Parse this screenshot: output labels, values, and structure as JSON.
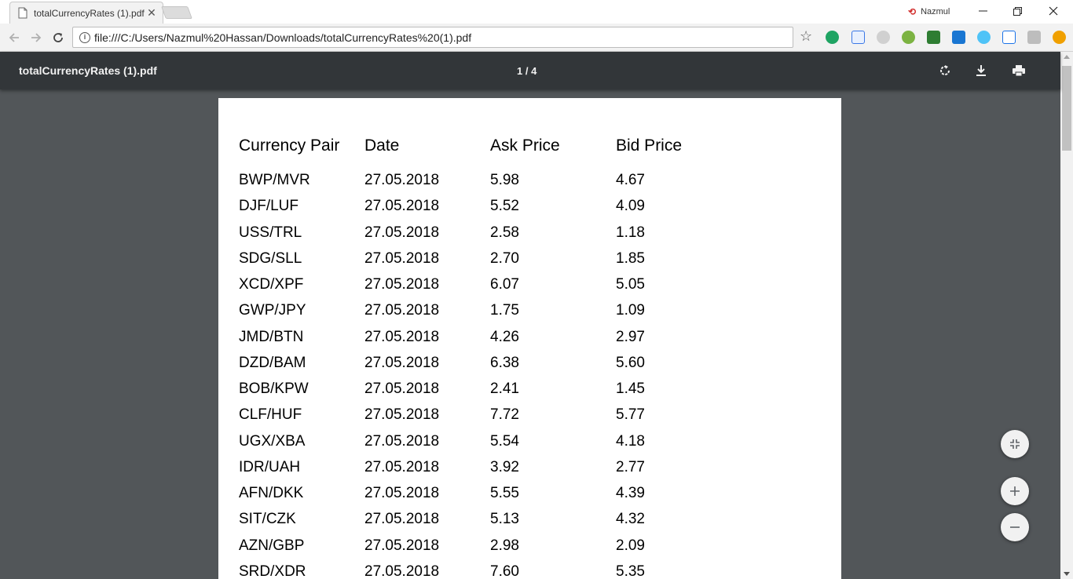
{
  "browser": {
    "tab_title": "totalCurrencyRates (1).pdf",
    "profile_name": "Nazmul",
    "url": "file:///C:/Users/Nazmul%20Hassan/Downloads/totalCurrencyRates%20(1).pdf"
  },
  "viewer": {
    "file_title": "totalCurrencyRates (1).pdf",
    "page_indicator": "1  /  4"
  },
  "table": {
    "headers": [
      "Currency Pair",
      "Date",
      "Ask Price",
      "Bid Price"
    ],
    "rows": [
      [
        "BWP/MVR",
        "27.05.2018",
        "5.98",
        "4.67"
      ],
      [
        "DJF/LUF",
        "27.05.2018",
        "5.52",
        "4.09"
      ],
      [
        "USS/TRL",
        "27.05.2018",
        "2.58",
        "1.18"
      ],
      [
        "SDG/SLL",
        "27.05.2018",
        "2.70",
        "1.85"
      ],
      [
        "XCD/XPF",
        "27.05.2018",
        "6.07",
        "5.05"
      ],
      [
        "GWP/JPY",
        "27.05.2018",
        "1.75",
        "1.09"
      ],
      [
        "JMD/BTN",
        "27.05.2018",
        "4.26",
        "2.97"
      ],
      [
        "DZD/BAM",
        "27.05.2018",
        "6.38",
        "5.60"
      ],
      [
        "BOB/KPW",
        "27.05.2018",
        "2.41",
        "1.45"
      ],
      [
        "CLF/HUF",
        "27.05.2018",
        "7.72",
        "5.77"
      ],
      [
        "UGX/XBA",
        "27.05.2018",
        "5.54",
        "4.18"
      ],
      [
        "IDR/UAH",
        "27.05.2018",
        "3.92",
        "2.77"
      ],
      [
        "AFN/DKK",
        "27.05.2018",
        "5.55",
        "4.39"
      ],
      [
        "SIT/CZK",
        "27.05.2018",
        "5.13",
        "4.32"
      ],
      [
        "AZN/GBP",
        "27.05.2018",
        "2.98",
        "2.09"
      ],
      [
        "SRD/XDR",
        "27.05.2018",
        "7.60",
        "5.35"
      ]
    ]
  }
}
